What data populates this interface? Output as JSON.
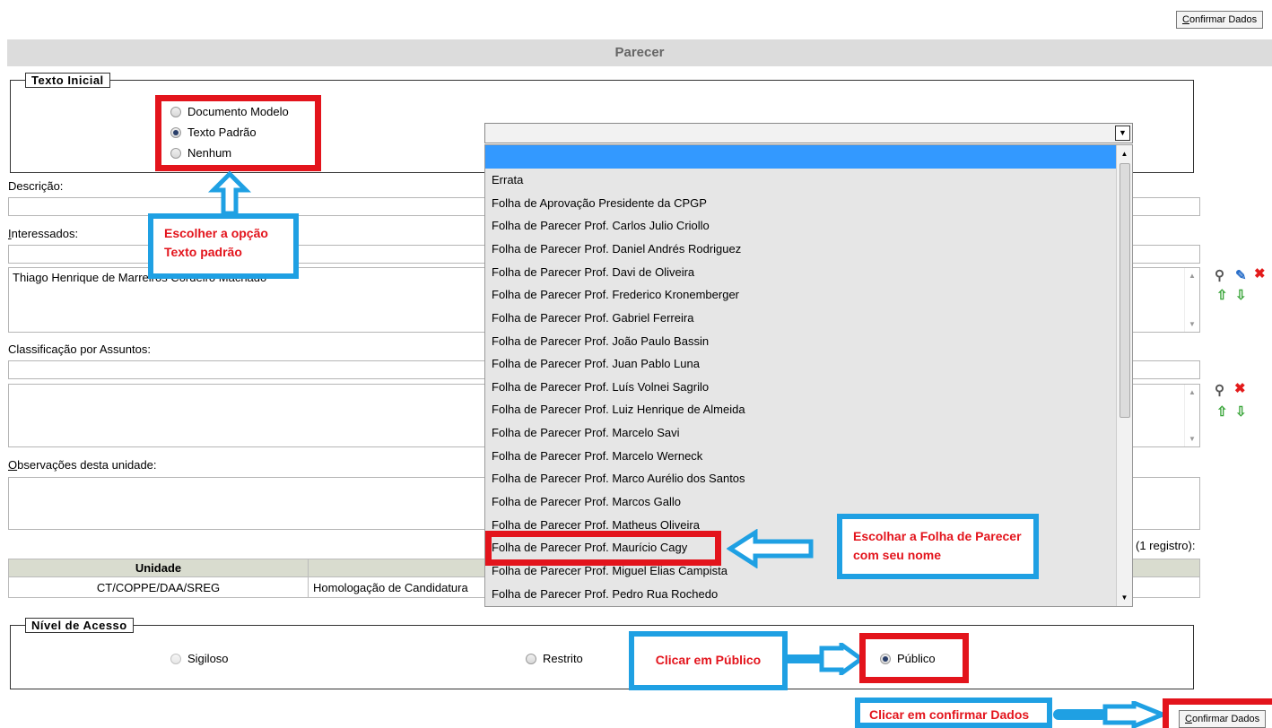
{
  "toolbar": {
    "confirm_label": "Confirmar Dados"
  },
  "page": {
    "title": "Parecer"
  },
  "texto_inicial": {
    "legend": "Texto Inicial",
    "options": [
      "Documento Modelo",
      "Texto Padrão",
      "Nenhum"
    ],
    "selected": "Texto Padrão"
  },
  "dropdown": {
    "selected_value": "",
    "options": [
      "Errata",
      "Folha de Aprovação Presidente da CPGP",
      "Folha de Parecer Prof. Carlos Julio Criollo",
      "Folha de Parecer Prof. Daniel Andrés Rodriguez",
      "Folha de Parecer Prof. Davi de Oliveira",
      "Folha de Parecer Prof. Frederico Kronemberger",
      "Folha de Parecer Prof. Gabriel Ferreira",
      "Folha de Parecer Prof. João Paulo Bassin",
      "Folha de Parecer Prof. Juan Pablo Luna",
      "Folha de Parecer Prof. Luís Volnei Sagrilo",
      "Folha de Parecer Prof. Luiz Henrique de Almeida",
      "Folha de Parecer Prof. Marcelo Savi",
      "Folha de Parecer Prof. Marcelo Werneck",
      "Folha de Parecer Prof. Marco Aurélio dos Santos",
      "Folha de Parecer Prof. Marcos Gallo",
      "Folha de Parecer Prof. Matheus Oliveira",
      "Folha de Parecer Prof. Maurício Cagy",
      "Folha de Parecer Prof. Miguel Elias Campista",
      "Folha de Parecer Prof. Pedro Rua Rochedo"
    ],
    "highlighted_option": "Folha de Parecer Prof. Maurício Cagy"
  },
  "form": {
    "descricao_label": "Descrição:",
    "interessados_label": "Interessados:",
    "interessados_value": "Thiago Henrique de Marreiros Cordeiro Machado",
    "classificacao_label": "Classificação por Assuntos:",
    "observacoes_label": "Observações desta unidade:",
    "registros_text": "(1 registro):"
  },
  "table": {
    "headers": [
      "Unidade",
      ""
    ],
    "rows": [
      [
        "CT/COPPE/DAA/SREG",
        "Homologação de Candidatura"
      ]
    ]
  },
  "nivel_acesso": {
    "legend": "Nível de Acesso",
    "options": [
      "Sigiloso",
      "Restrito",
      "Público"
    ],
    "selected": "Público"
  },
  "annotations": {
    "choose_option": [
      "Escolher a opção",
      "Texto padrão"
    ],
    "choose_folha": [
      "Escolhar a Folha de Parecer",
      "com seu nome"
    ],
    "click_publico": "Clicar em Público",
    "click_confirm": "Clicar em confirmar Dados"
  },
  "colors": {
    "annotation_red": "#e3141c",
    "annotation_blue": "#1fa0e3",
    "highlight": "#3399ff"
  }
}
